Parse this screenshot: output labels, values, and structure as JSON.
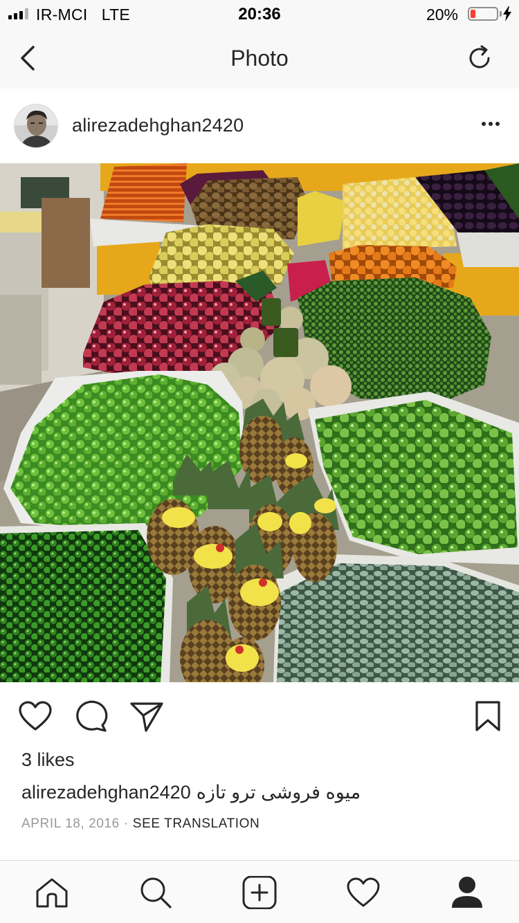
{
  "status_bar": {
    "carrier": "IR-MCI",
    "network": "LTE",
    "time": "20:36",
    "battery_percent": "20%",
    "battery_level": 0.2,
    "battery_color": "#ff3b30"
  },
  "nav": {
    "title": "Photo",
    "back_icon": "chevron-left-icon",
    "refresh_icon": "refresh-icon"
  },
  "post": {
    "username": "alirezadehghan2420",
    "more_icon": "more-horizontal-icon",
    "image_alt": "fruit market stall photo",
    "actions": {
      "like_icon": "heart-outline-icon",
      "comment_icon": "comment-icon",
      "share_icon": "send-icon",
      "save_icon": "bookmark-icon"
    },
    "likes_text": "3 likes",
    "caption_user": "alirezadehghan2420",
    "caption_text": "میوه فروشی ترو تازه",
    "date": "APRIL 18, 2016",
    "separator": "·",
    "translation_link": "SEE TRANSLATION"
  },
  "tab_bar": {
    "items": [
      {
        "icon": "home-icon"
      },
      {
        "icon": "search-icon"
      },
      {
        "icon": "add-post-icon"
      },
      {
        "icon": "activity-heart-icon"
      },
      {
        "icon": "profile-icon",
        "active": true
      }
    ]
  },
  "colors": {
    "text": "#262626",
    "muted": "#999999",
    "bar_background": "#f8f8f8"
  }
}
